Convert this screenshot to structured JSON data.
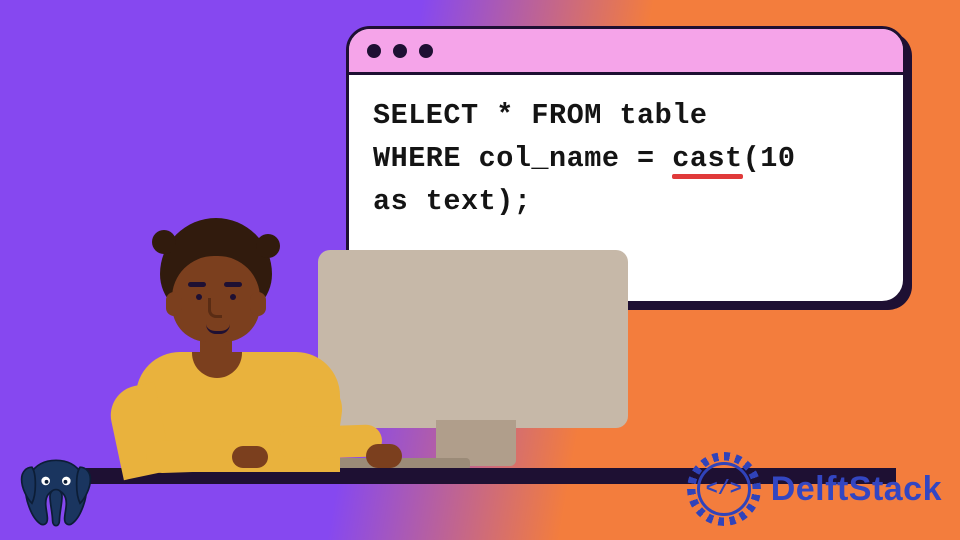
{
  "code": {
    "line1_a": "SELECT * FROM table",
    "line2_a": "WHERE col_name = ",
    "cast_word": "cast",
    "line2_b": "(10",
    "line3": "as text);"
  },
  "brand": {
    "name": "DelftStack",
    "mark_text": "</>"
  },
  "accent": {
    "underline": "#e03a3a",
    "titlebar": "#f5a4e9",
    "brand_blue": "#3346c2"
  }
}
